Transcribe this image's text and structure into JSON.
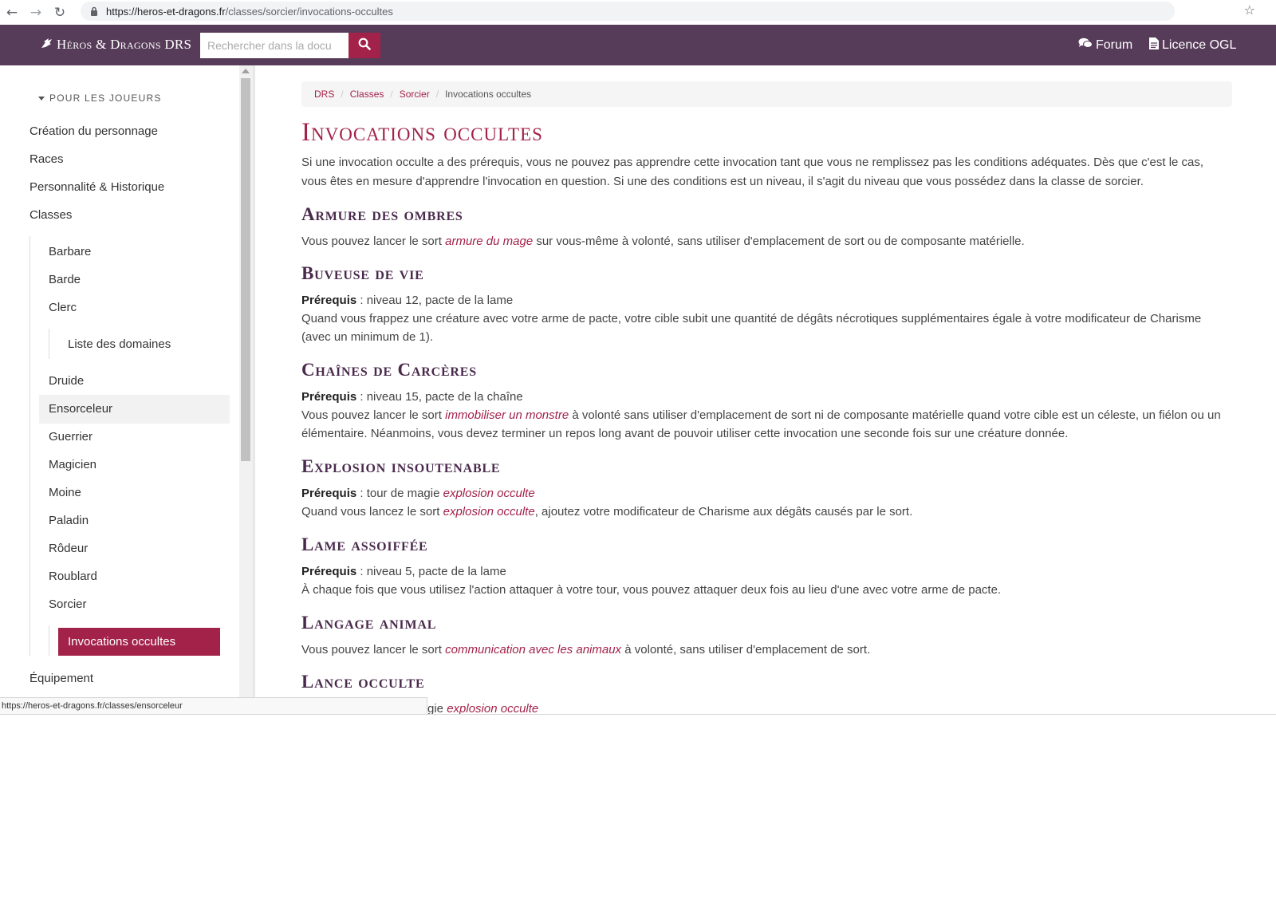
{
  "browser": {
    "url_host": "https://heros-et-dragons.fr",
    "url_path": "/classes/sorcier/invocations-occultes"
  },
  "navbar": {
    "brand": "Héros & Dragons DRS",
    "search_placeholder": "Rechercher dans la docu",
    "forum_label": "Forum",
    "licence_label": "Licence OGL"
  },
  "sidebar": {
    "section_title": "POUR LES JOUEURS",
    "items": {
      "creation": "Création du personnage",
      "races": "Races",
      "personnalite": "Personnalité & Historique",
      "classes": "Classes",
      "barbare": "Barbare",
      "barde": "Barde",
      "clerc": "Clerc",
      "domaines": "Liste des domaines",
      "druide": "Druide",
      "ensorceleur": "Ensorceleur",
      "guerrier": "Guerrier",
      "magicien": "Magicien",
      "moine": "Moine",
      "paladin": "Paladin",
      "rodeur": "Rôdeur",
      "roublard": "Roublard",
      "sorcier": "Sorcier",
      "invocations": "Invocations occultes",
      "equipement": "Équipement"
    }
  },
  "breadcrumb": {
    "drs": "DRS",
    "classes": "Classes",
    "sorcier": "Sorcier",
    "current": "Invocations occultes"
  },
  "content": {
    "title": "Invocations occultes",
    "intro": "Si une invocation occulte a des prérequis, vous ne pouvez pas apprendre cette invocation tant que vous ne remplissez pas les conditions adéquates. Dès que c'est le cas, vous êtes en mesure d'apprendre l'invocation en question. Si une des conditions est un niveau, il s'agit du niveau que vous possédez dans la classe de sorcier.",
    "prereq_label": "Prérequis",
    "armure": {
      "title": "Armure des ombres",
      "text_before": "Vous pouvez lancer le sort ",
      "spell": "armure du mage",
      "text_after": " sur vous-même à volonté, sans utiliser d'emplacement de sort ou de composante matérielle."
    },
    "buveuse": {
      "title": "Buveuse de vie",
      "prereq": " : niveau 12, pacte de la lame",
      "text": "Quand vous frappez une créature avec votre arme de pacte, votre cible subit une quantité de dégâts nécrotiques supplémentaires égale à votre modificateur de Charisme (avec un minimum de 1)."
    },
    "chaines": {
      "title": "Chaînes de Carcères",
      "prereq": " : niveau 15, pacte de la chaîne",
      "text_before": "Vous pouvez lancer le sort ",
      "spell": "immobiliser un monstre",
      "text_after": " à volonté sans utiliser d'emplacement de sort ni de composante matérielle quand votre cible est un céleste, un fiélon ou un élémentaire. Néanmoins, vous devez terminer un repos long avant de pouvoir utiliser cette invocation une seconde fois sur une créature donnée."
    },
    "explosion": {
      "title": "Explosion insoutenable",
      "prereq": " : tour de magie ",
      "prereq_spell": "explosion occulte",
      "text_before": "Quand vous lancez le sort ",
      "spell": "explosion occulte",
      "text_after": ", ajoutez votre modificateur de Charisme aux dégâts causés par le sort."
    },
    "lame": {
      "title": "Lame assoiffée",
      "prereq": " : niveau 5, pacte de la lame",
      "text": "À chaque fois que vous utilisez l'action attaquer à votre tour, vous pouvez attaquer deux fois au lieu d'une avec votre arme de pacte."
    },
    "langage": {
      "title": "Langage animal",
      "text_before": "Vous pouvez lancer le sort ",
      "spell": "communication avec les animaux",
      "text_after": " à volonté, sans utiliser d'emplacement de sort."
    },
    "lance": {
      "title": "Lance occulte",
      "partial_text": "gie ",
      "spell": "explosion occulte"
    }
  },
  "status_bar": {
    "url": "https://heros-et-dragons.fr/classes/ensorceleur"
  }
}
